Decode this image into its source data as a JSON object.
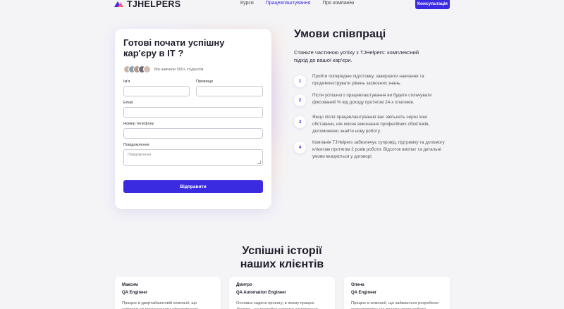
{
  "header": {
    "logo_text": "TJHELPERS",
    "nav": [
      {
        "label": "Курси",
        "active": false
      },
      {
        "label": "Працевлаштування",
        "active": true
      },
      {
        "label": "Про компанію",
        "active": false
      }
    ],
    "cta_label": "Консультація"
  },
  "form": {
    "title": "Готові почати успішну кар'єру в IT ?",
    "students_text": "Ми навчили 500+ студентів",
    "first_name_label": "Ім'я",
    "last_name_label": "Прізвище",
    "email_label": "Email",
    "phone_label": "Номер телефону",
    "message_label": "Повідомлення",
    "message_placeholder": "Повідомлення",
    "submit_label": "Відправити"
  },
  "terms": {
    "title": "Умови співпраці",
    "subtitle": "Станьте частиною успіху з TJHelpers: комплексний підхід до вашої кар'єри.",
    "steps": [
      {
        "num": "1",
        "text": "Пройти попередню підготовку, завершити навчання та продемонструвати рівень засвоєних знань."
      },
      {
        "num": "2",
        "text": "Після успішного працевлаштування ви будете сплачувати фіксований % від доходу протягом 24-х платежів."
      },
      {
        "num": "3",
        "text": "Якщо після працевлаштування вас звільнять через інші обставини, ніж якісне виконання професійних обов'язків, допоможемо знайти нову роботу."
      },
      {
        "num": "4",
        "text": "Компанія TJHelpers забезпечує супровід, підтримку та допомогу клієнтам протягом 2 років роботи. Відсоток виплат та детальні умови вказуються у договорі."
      }
    ]
  },
  "stories": {
    "title_line1": "Успішні історії",
    "title_line2": "наших клієнтів",
    "cards": [
      {
        "name": "Максим",
        "role": "QA Engineer",
        "text": "Працює в двертайзинговій компанії, що займається покращенням ефективності"
      },
      {
        "name": "Дмитро",
        "role": "QA Automation Engineer",
        "text": "Основна задача проєкту, в якому працює Дмитро - це розробка системи замовлення"
      },
      {
        "name": "Олена",
        "role": "QA Engineer",
        "text": "Працює в компанії, що займається розробкою маркетплейсу. На початку свого роботи"
      }
    ]
  },
  "colors": {
    "accent": "#3a2be0",
    "background": "#f4f4f7",
    "logo_secondary": "#ff5f7a"
  }
}
